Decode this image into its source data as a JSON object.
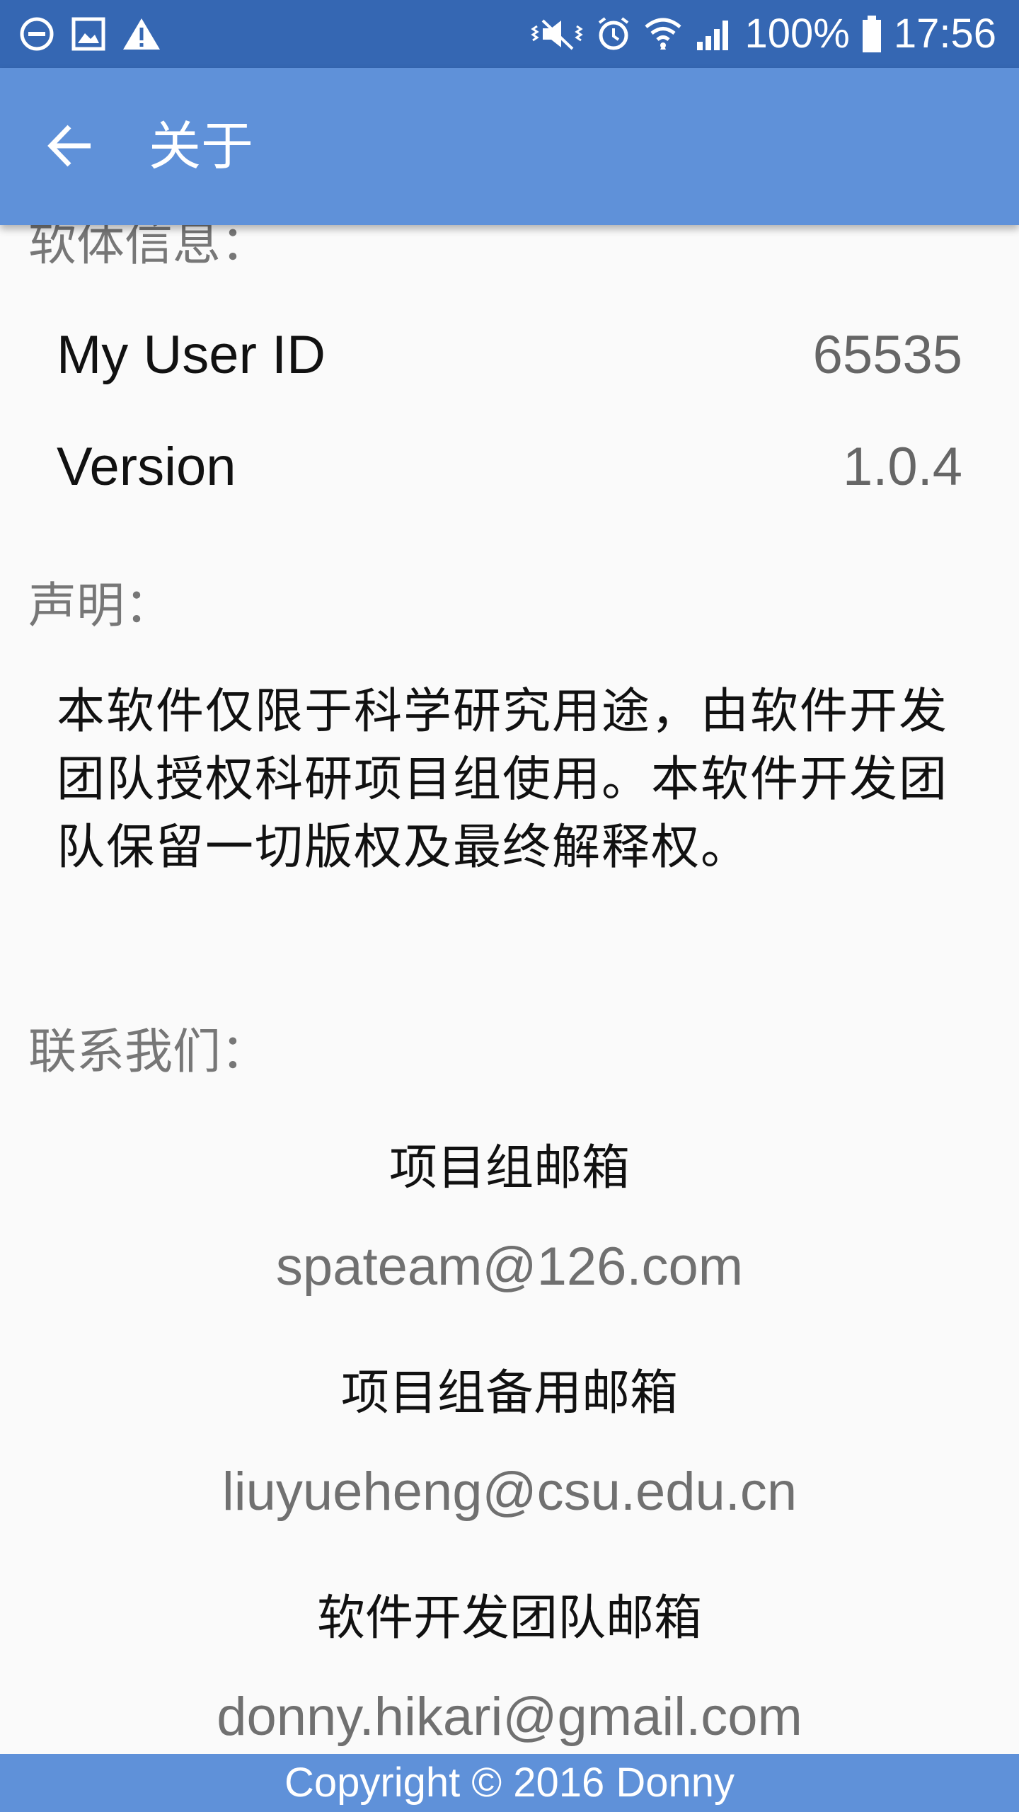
{
  "statusbar": {
    "battery": "100%",
    "time": "17:56",
    "icons_left": [
      "dnd-icon",
      "image-icon",
      "warning-icon"
    ],
    "icons_right": [
      "mute-icon",
      "alarm-icon",
      "wifi-icon",
      "signal-icon",
      "battery-icon"
    ]
  },
  "appbar": {
    "back_icon": "arrow-left-icon",
    "title": "关于"
  },
  "software_info": {
    "header": "软体信息：",
    "rows": [
      {
        "label": "My User ID",
        "value": "65535"
      },
      {
        "label": "Version",
        "value": "1.0.4"
      }
    ]
  },
  "statement": {
    "header": "声明：",
    "text": "本软件仅限于科学研究用途，由软件开发团队授权科研项目组使用。本软件开发团队保留一切版权及最终解释权。"
  },
  "contact": {
    "header": "联系我们：",
    "items": [
      {
        "label": "项目组邮箱",
        "email": "spateam@126.com"
      },
      {
        "label": "项目组备用邮箱",
        "email": "liuyueheng@csu.edu.cn"
      },
      {
        "label": "软件开发团队邮箱",
        "email": "donny.hikari@gmail.com"
      }
    ]
  },
  "footer": {
    "copyright": "Copyright © 2016  Donny"
  },
  "colors": {
    "statusbar": "#3567b3",
    "appbar": "#5f91d9",
    "background": "#fafafa"
  }
}
